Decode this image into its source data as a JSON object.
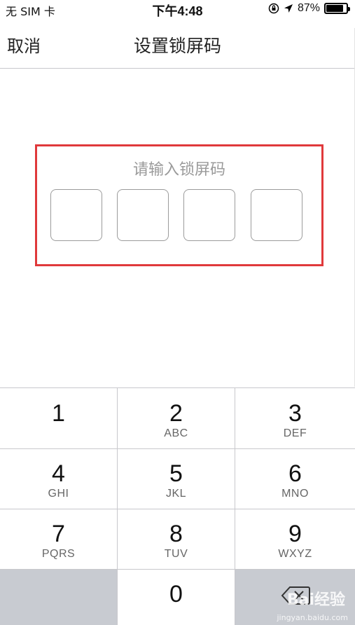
{
  "status_bar": {
    "carrier": "无 SIM 卡",
    "time": "下午4:48",
    "battery_percent": "87%",
    "battery_level": 0.87,
    "icons": [
      "orientation-lock-icon",
      "location-arrow-icon",
      "battery-icon"
    ]
  },
  "nav": {
    "cancel_label": "取消",
    "title": "设置锁屏码"
  },
  "passcode": {
    "prompt": "请输入锁屏码",
    "digit_count": 4,
    "highlight_color": "#e0393b"
  },
  "keypad": {
    "keys": [
      {
        "digit": "1",
        "letters": ""
      },
      {
        "digit": "2",
        "letters": "ABC"
      },
      {
        "digit": "3",
        "letters": "DEF"
      },
      {
        "digit": "4",
        "letters": "GHI"
      },
      {
        "digit": "5",
        "letters": "JKL"
      },
      {
        "digit": "6",
        "letters": "MNO"
      },
      {
        "digit": "7",
        "letters": "PQRS"
      },
      {
        "digit": "8",
        "letters": "TUV"
      },
      {
        "digit": "9",
        "letters": "WXYZ"
      },
      {
        "digit": "0",
        "letters": ""
      }
    ],
    "backspace_icon": "backspace-icon"
  },
  "watermark": {
    "text": "Bai经验",
    "url_text": "jingyan.baidu.com"
  }
}
